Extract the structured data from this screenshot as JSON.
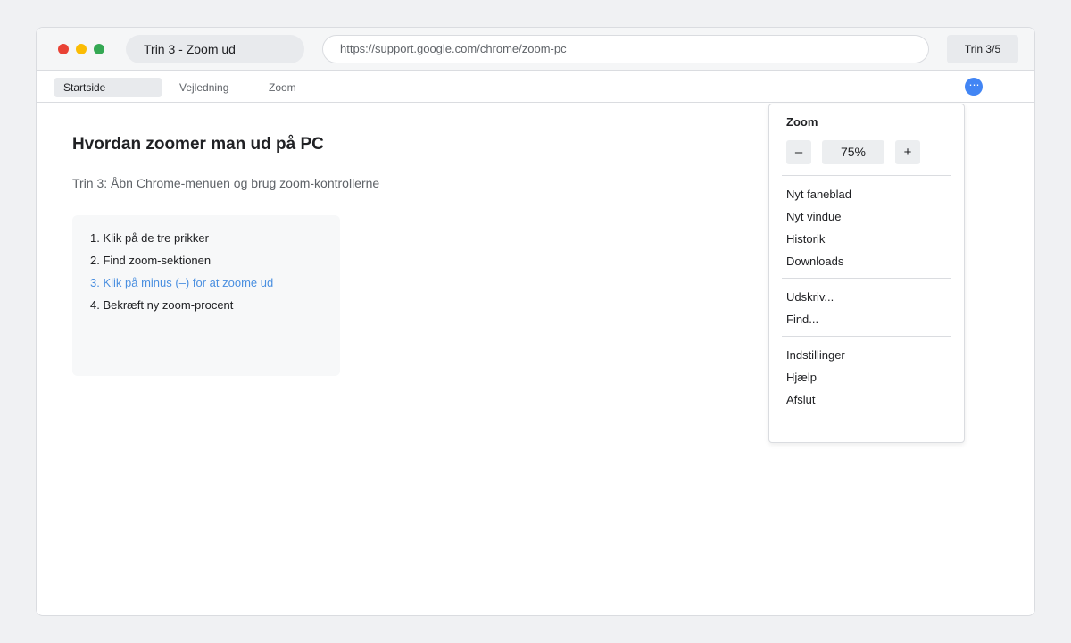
{
  "window": {
    "tab_title": "Trin 3 - Zoom ud",
    "url": "https://support.google.com/chrome/zoom-pc",
    "step_badge": "Trin 3/5"
  },
  "nav": {
    "items": [
      {
        "label": "Startside",
        "active": true
      },
      {
        "label": "Vejledning",
        "active": false
      },
      {
        "label": "Zoom",
        "active": false
      }
    ],
    "menu_button_glyph": "⋯"
  },
  "content": {
    "heading": "Hvordan zoomer man ud på PC",
    "subtitle": "Trin 3: Åbn Chrome-menuen og brug zoom-kontrollerne",
    "steps": [
      "1. Klik på de tre prikker",
      "2. Find zoom-sektionen",
      "3. Klik på minus (–) for at zoome ud",
      "4. Bekræft ny zoom-procent"
    ],
    "current_step_index": 2
  },
  "menu": {
    "zoom_title": "Zoom",
    "zoom_minus": "–",
    "zoom_value": "75%",
    "zoom_plus": "+",
    "items": [
      "Nyt faneblad",
      "Nyt vindue",
      "Historik",
      "Downloads",
      "Udskriv...",
      "Find...",
      "Indstillinger",
      "Hjælp",
      "Afslut"
    ]
  },
  "colors": {
    "accent": "#4285f4",
    "current_step": "#4a8fe0",
    "traffic_red": "#e94235",
    "traffic_yellow": "#fbbc04",
    "traffic_green": "#34a853"
  },
  "icons": {
    "menu_button": "three-dots-icon",
    "window_controls": [
      "close-dot-icon",
      "minimize-dot-icon",
      "maximize-dot-icon"
    ]
  }
}
